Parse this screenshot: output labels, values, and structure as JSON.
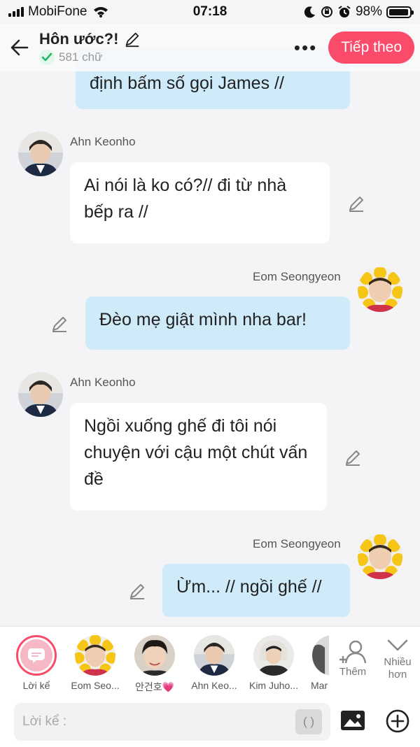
{
  "status_bar": {
    "carrier": "MobiFone",
    "time": "07:18",
    "battery": "98%",
    "battery_level": 0.98
  },
  "header": {
    "title": "Hôn ước?!",
    "word_count": "581 chữ",
    "next_label": "Tiếp theo"
  },
  "messages": [
    {
      "side": "right",
      "speaker": "",
      "text": "định bấm số gọi James //"
    },
    {
      "side": "left",
      "speaker": "Ahn Keonho",
      "text": "Ai nói là ko có?// đi từ nhà bếp ra //"
    },
    {
      "side": "right",
      "speaker": "Eom Seongyeon",
      "text": "Đèo mẹ giật mình nha bar!"
    },
    {
      "side": "left",
      "speaker": "Ahn Keonho",
      "text": "Ngồi xuống ghế đi tôi nói chuyện với cậu một chút vấn đề"
    },
    {
      "side": "right",
      "speaker": "Eom Seongyeon",
      "text": "Ừm... // ngồi ghế //"
    }
  ],
  "characters": [
    {
      "label": "Lời kể"
    },
    {
      "label": "Eom Seo..."
    },
    {
      "label": "안건호💗"
    },
    {
      "label": "Ahn Keo..."
    },
    {
      "label": "Kim Juho..."
    },
    {
      "label": "Mar"
    }
  ],
  "tools": {
    "add_label": "Thêm",
    "more_label": "Nhiều hơn"
  },
  "input": {
    "placeholder": "Lời kể :",
    "paren_label": "( )"
  }
}
